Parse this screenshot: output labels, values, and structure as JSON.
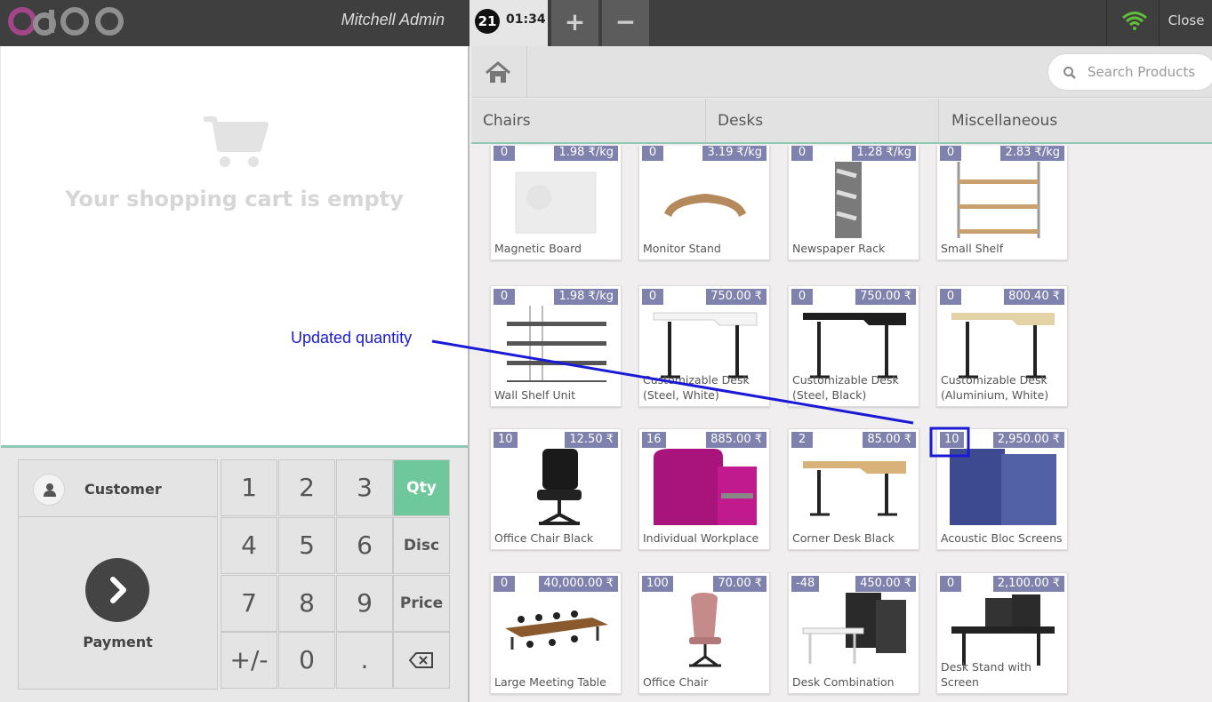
{
  "topbar": {
    "cashier": "Mitchell Admin",
    "order_number": "21",
    "order_time": "01:34",
    "add_label": "+",
    "remove_label": "−",
    "close_label": "Close"
  },
  "cart": {
    "empty_text": "Your shopping cart is empty"
  },
  "controls": {
    "customer_label": "Customer",
    "payment_label": "Payment"
  },
  "numpad": {
    "keys": [
      "1",
      "2",
      "3",
      "Qty",
      "4",
      "5",
      "6",
      "Disc",
      "7",
      "8",
      "9",
      "Price",
      "+/-",
      "0",
      ".",
      "⌫"
    ],
    "active_mode": "Qty"
  },
  "search": {
    "placeholder": "Search Products"
  },
  "categories": [
    "Chairs",
    "Desks",
    "Miscellaneous"
  ],
  "products": [
    {
      "name": "Magnetic Board",
      "qty": "0",
      "price": "1.98 ₹/kg"
    },
    {
      "name": "Monitor Stand",
      "qty": "0",
      "price": "3.19 ₹/kg"
    },
    {
      "name": "Newspaper Rack",
      "qty": "0",
      "price": "1.28 ₹/kg"
    },
    {
      "name": "Small Shelf",
      "qty": "0",
      "price": "2.83 ₹/kg"
    },
    {
      "name": "Wall Shelf Unit",
      "qty": "0",
      "price": "1.98 ₹/kg"
    },
    {
      "name": "Customizable Desk (Steel, White)",
      "qty": "0",
      "price": "750.00 ₹"
    },
    {
      "name": "Customizable Desk (Steel, Black)",
      "qty": "0",
      "price": "750.00 ₹"
    },
    {
      "name": "Customizable Desk (Aluminium, White)",
      "qty": "0",
      "price": "800.40 ₹"
    },
    {
      "name": "Office Chair Black",
      "qty": "10",
      "price": "12.50 ₹"
    },
    {
      "name": "Individual Workplace",
      "qty": "16",
      "price": "885.00 ₹"
    },
    {
      "name": "Corner Desk Black",
      "qty": "2",
      "price": "85.00 ₹"
    },
    {
      "name": "Acoustic Bloc Screens",
      "qty": "10",
      "price": "2,950.00 ₹"
    },
    {
      "name": "Large Meeting Table",
      "qty": "0",
      "price": "40,000.00 ₹"
    },
    {
      "name": "Office Chair",
      "qty": "100",
      "price": "70.00 ₹"
    },
    {
      "name": "Desk Combination",
      "qty": "-48",
      "price": "450.00 ₹"
    },
    {
      "name": "Desk Stand with Screen",
      "qty": "0",
      "price": "2,100.00 ₹"
    }
  ],
  "annotation": {
    "text": "Updated quantity",
    "color": "#1a1ad6"
  },
  "colors": {
    "accent": "#6ec89b",
    "tag": "#7f82ac",
    "topbar": "#3f3f3f"
  }
}
